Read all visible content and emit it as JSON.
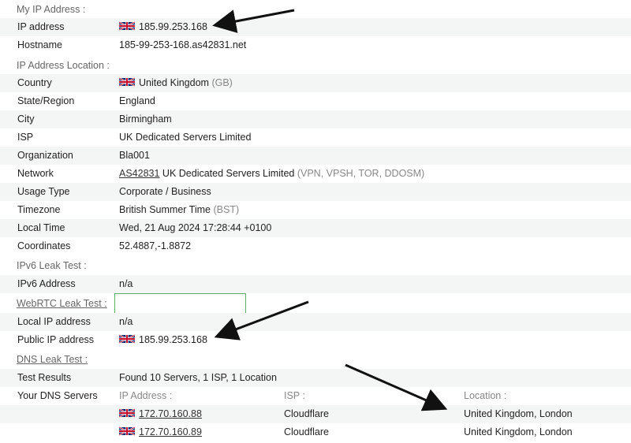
{
  "sections": {
    "my_ip": "My IP Address :",
    "location": "IP Address Location :",
    "ipv6": "IPv6 Leak Test :",
    "webrtc": "WebRTC Leak Test :",
    "dns": "DNS Leak Test :"
  },
  "my_ip": {
    "ip_label": "IP address",
    "ip_value": "185.99.253.168",
    "hostname_label": "Hostname",
    "hostname_value": "185-99-253-168.as42831.net"
  },
  "location": {
    "country_label": "Country",
    "country_value": "United Kingdom",
    "country_code": "(GB)",
    "state_label": "State/Region",
    "state_value": "England",
    "city_label": "City",
    "city_value": "Birmingham",
    "isp_label": "ISP",
    "isp_value": "UK Dedicated Servers Limited",
    "org_label": "Organization",
    "org_value": "Bla001",
    "network_label": "Network",
    "network_asn": "AS42831",
    "network_name": "UK Dedicated Servers Limited",
    "network_tags": "(VPN, VPSH, TOR, DDOSM)",
    "usage_label": "Usage Type",
    "usage_value": "Corporate / Business",
    "tz_label": "Timezone",
    "tz_value": "British Summer Time",
    "tz_abbr": "(BST)",
    "localtime_label": "Local Time",
    "localtime_value": "Wed, 21 Aug 2024 17:28:44 +0100",
    "coords_label": "Coordinates",
    "coords_value": "52.4887,-1.8872"
  },
  "ipv6": {
    "addr_label": "IPv6 Address",
    "addr_value": "n/a"
  },
  "webrtc": {
    "local_label": "Local IP address",
    "local_value": "n/a",
    "public_label": "Public IP address",
    "public_value": "185.99.253.168"
  },
  "dns": {
    "results_label": "Test Results",
    "results_value": "Found 10 Servers, 1 ISP, 1 Location",
    "servers_label": "Your DNS Servers",
    "col_ip": "IP Address :",
    "col_isp": "ISP :",
    "col_location": "Location :",
    "servers": [
      {
        "ip": "172.70.160.88",
        "isp": "Cloudflare",
        "location": "United Kingdom, London"
      },
      {
        "ip": "172.70.160.89",
        "isp": "Cloudflare",
        "location": "United Kingdom, London"
      }
    ]
  },
  "icons": {
    "flag": "uk-flag-icon",
    "arrow": "arrow-annotation"
  },
  "colors": {
    "row_shade": "#f4f5f5",
    "section_text": "#666666",
    "muted_text": "#888888",
    "webrtc_border": "#5fae6a"
  }
}
